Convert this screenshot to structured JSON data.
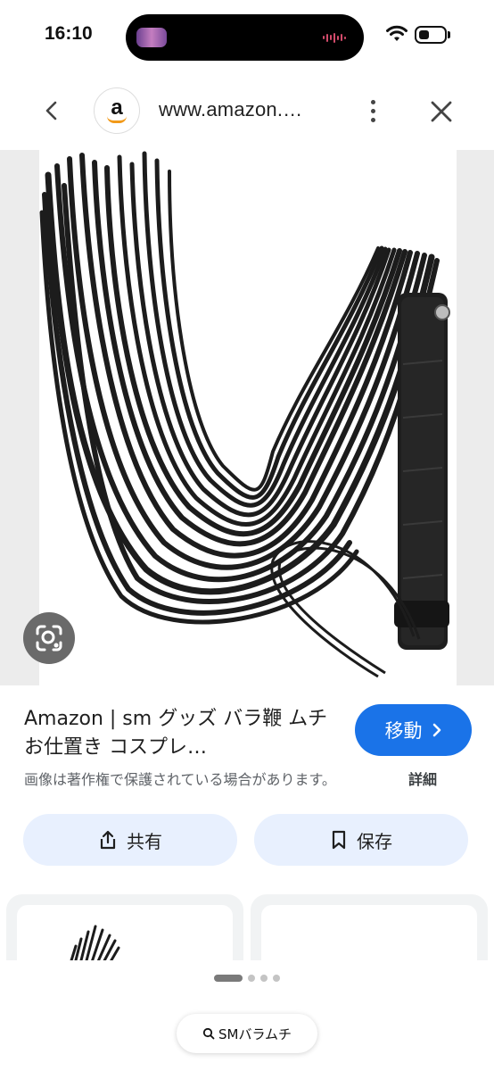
{
  "status_bar": {
    "time": "16:10",
    "wifi_icon": "wifi-icon",
    "battery_icon": "battery-icon"
  },
  "browser": {
    "back_icon": "chevron-left-icon",
    "site_icon": "amazon-logo",
    "url": "www.amazon.…",
    "more_icon": "more-vertical-icon",
    "close_icon": "close-icon"
  },
  "image": {
    "lens_icon": "google-lens-icon"
  },
  "result": {
    "title": "Amazon | sm グッズ バラ鞭 ムチ お仕置き コスプレ…",
    "visit_label": "移動",
    "copyright_notice": "画像は著作権で保護されている場合があります。",
    "details_label": "詳細"
  },
  "actions": {
    "share_label": "共有",
    "save_label": "保存"
  },
  "search": {
    "query": "SMバラムチ"
  },
  "colors": {
    "accent": "#1a73e8",
    "pill_bg": "#e8f0fe"
  }
}
